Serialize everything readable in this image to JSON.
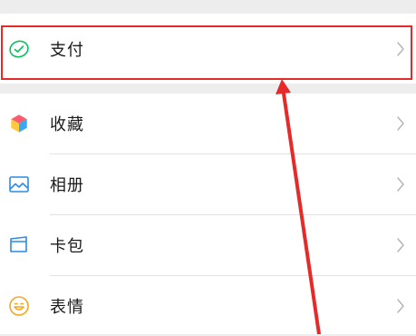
{
  "menu": {
    "pay": {
      "label": "支付",
      "icon": "wallet-smile-icon"
    },
    "items": [
      {
        "label": "收藏",
        "icon": "favorites-cube-icon"
      },
      {
        "label": "相册",
        "icon": "photo-album-icon"
      },
      {
        "label": "卡包",
        "icon": "card-wallet-icon"
      },
      {
        "label": "表情",
        "icon": "sticker-smile-icon"
      }
    ]
  },
  "colors": {
    "pay_icon": "#07c160",
    "album_icon": "#2b8ce8",
    "cards_icon": "#2b8ce8",
    "sticker_icon": "#f5a623",
    "annotation": "#e52a2a",
    "background": "#ededed"
  }
}
